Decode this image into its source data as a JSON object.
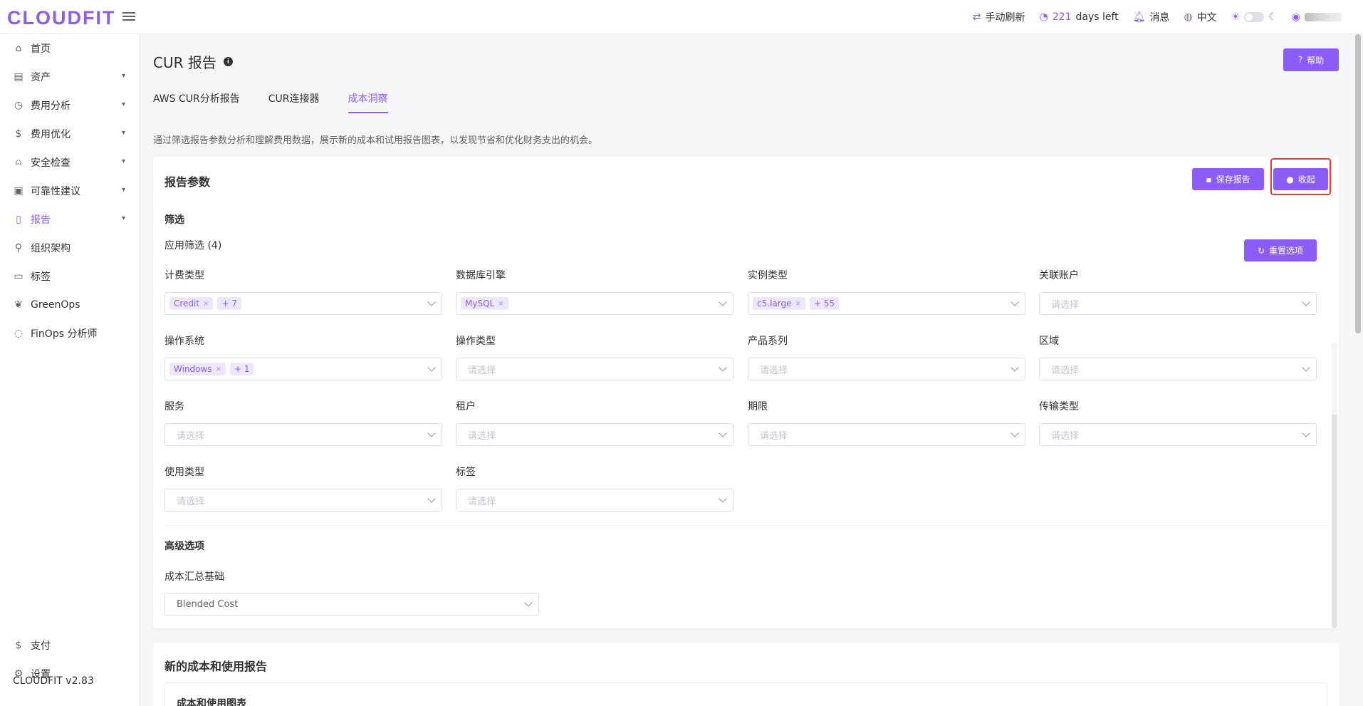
{
  "brand": {
    "logo": "CLOUDFIT",
    "version": "CLOUDFIT v2.83"
  },
  "topbar": {
    "refresh": "手动刷新",
    "days_count": "221",
    "days_text": "days left",
    "messages": "消息",
    "language": "中文"
  },
  "sidebar": {
    "items": [
      {
        "label": "首页",
        "icon": "home-icon"
      },
      {
        "label": "资产",
        "icon": "asset-icon",
        "expandable": true
      },
      {
        "label": "费用分析",
        "icon": "dashboard-icon",
        "expandable": true
      },
      {
        "label": "费用优化",
        "icon": "dollar-icon",
        "expandable": true
      },
      {
        "label": "安全检查",
        "icon": "alarm-icon",
        "expandable": true
      },
      {
        "label": "可靠性建议",
        "icon": "document-check-icon",
        "expandable": true
      },
      {
        "label": "报告",
        "icon": "report-icon",
        "expandable": true,
        "active": true
      },
      {
        "label": "组织架构",
        "icon": "org-chart-icon"
      },
      {
        "label": "标签",
        "icon": "bookmark-icon"
      },
      {
        "label": "GreenOps",
        "icon": "leaf-icon"
      },
      {
        "label": "FinOps 分析师",
        "icon": "analyst-icon"
      }
    ],
    "bottom": [
      {
        "label": "支付",
        "icon": "dollar-icon"
      },
      {
        "label": "设置",
        "icon": "gear-icon"
      }
    ]
  },
  "page": {
    "title": "CUR 报告",
    "help": "帮助",
    "tabs": [
      "AWS CUR分析报告",
      "CUR连接器",
      "成本洞察"
    ],
    "active_tab": 2,
    "description": "通过筛选报告参数分析和理解费用数据，展示新的成本和试用报告图表，以发现节省和优化财务支出的机会。"
  },
  "params": {
    "title": "报告参数",
    "save_btn": "保存报告",
    "collapse_btn": "收起",
    "filter_title": "筛选",
    "applied": "应用筛选 (4)",
    "reset_btn": "重置选项",
    "placeholder": "请选择",
    "fields": [
      {
        "label": "计费类型",
        "tags": [
          "Credit",
          "+ 7"
        ]
      },
      {
        "label": "数据库引擎",
        "tags": [
          "MySQL"
        ]
      },
      {
        "label": "实例类型",
        "tags": [
          "c5.large",
          "+ 55"
        ]
      },
      {
        "label": "关联账户",
        "tags": []
      },
      {
        "label": "操作系统",
        "tags": [
          "Windows",
          "+ 1"
        ]
      },
      {
        "label": "操作类型",
        "tags": []
      },
      {
        "label": "产品系列",
        "tags": []
      },
      {
        "label": "区域",
        "tags": []
      },
      {
        "label": "服务",
        "tags": []
      },
      {
        "label": "租户",
        "tags": []
      },
      {
        "label": "期限",
        "tags": []
      },
      {
        "label": "传输类型",
        "tags": []
      },
      {
        "label": "使用类型",
        "tags": []
      },
      {
        "label": "标签",
        "tags": []
      }
    ],
    "advanced_title": "高级选项",
    "cost_basis_label": "成本汇总基础",
    "cost_basis_value": "Blended Cost"
  },
  "report": {
    "title": "新的成本和使用报告",
    "chart_title": "成本和使用图表"
  }
}
